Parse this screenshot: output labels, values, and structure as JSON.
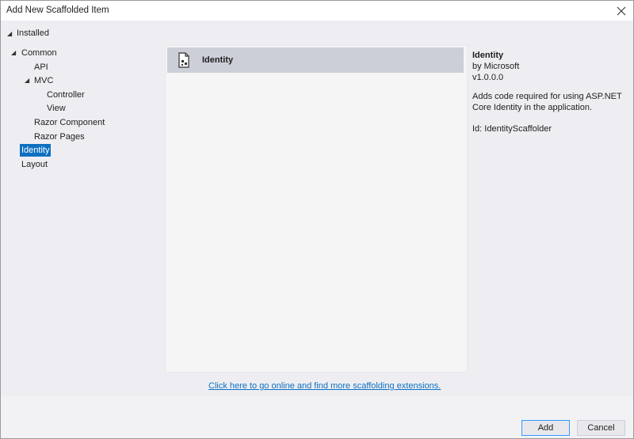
{
  "window": {
    "title": "Add New Scaffolded Item"
  },
  "tree": {
    "installed": "Installed",
    "nodes": [
      {
        "label": "Common"
      },
      {
        "label": "API"
      },
      {
        "label": "MVC"
      },
      {
        "label": "Controller"
      },
      {
        "label": "View"
      },
      {
        "label": "Razor Component"
      },
      {
        "label": "Razor Pages"
      },
      {
        "label": "Identity"
      },
      {
        "label": "Layout"
      }
    ]
  },
  "list": {
    "items": [
      {
        "label": "Identity",
        "icon": "scaffold-file-icon"
      }
    ]
  },
  "details": {
    "name": "Identity",
    "author": "by Microsoft",
    "version": "v1.0.0.0",
    "description": "Adds code required for using ASP.NET Core Identity in the application.",
    "id": "Id: IdentityScaffolder"
  },
  "link": {
    "text": "Click here to go online and find more scaffolding extensions."
  },
  "buttons": {
    "add": "Add",
    "cancel": "Cancel"
  },
  "colors": {
    "selection": "#0e70c0",
    "list_selected": "#ccced8",
    "dialog_bg": "#eeeef2"
  }
}
